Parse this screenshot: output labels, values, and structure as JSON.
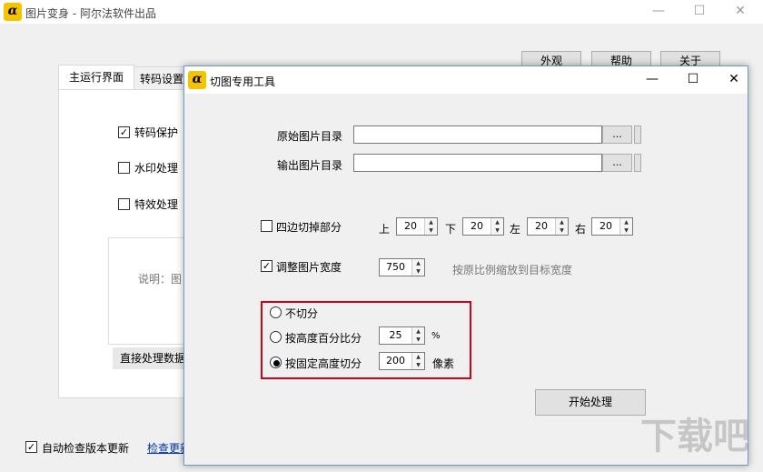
{
  "main_window": {
    "title": "图片变身 - 阿尔法软件出品",
    "logo_text": "α",
    "controls": {
      "minimize": "—",
      "maximize": "☐",
      "close": "✕"
    },
    "buttons": {
      "appearance": "外观",
      "help": "帮助",
      "about": "关于"
    },
    "tabs": [
      "主运行界面",
      "转码设置"
    ],
    "options": {
      "transcode_protect": {
        "label": "转码保护",
        "checked": true
      },
      "watermark": {
        "label": "水印处理",
        "checked": false
      },
      "effects": {
        "label": "特效处理",
        "checked": false
      }
    },
    "description_prefix": "说明：图",
    "direct_process_button": "直接处理数据",
    "auto_check_update": {
      "label": "自动检查版本更新",
      "checked": true
    },
    "check_update_link": "检查更新"
  },
  "dialog": {
    "title": "切图专用工具",
    "logo_text": "α",
    "controls": {
      "minimize": "—",
      "maximize": "☐",
      "close": "✕"
    },
    "source_dir": {
      "label": "原始图片目录",
      "value": "",
      "browse": "..."
    },
    "output_dir": {
      "label": "输出图片目录",
      "value": "",
      "browse": "..."
    },
    "trim_edges": {
      "label": "四边切掉部分",
      "checked": false,
      "top": {
        "label": "上",
        "value": "20"
      },
      "bottom": {
        "label": "下",
        "value": "20"
      },
      "left": {
        "label": "左",
        "value": "20"
      },
      "right": {
        "label": "右",
        "value": "20"
      }
    },
    "resize_width": {
      "label": "调整图片宽度",
      "checked": true,
      "value": "750",
      "hint": "按原比例缩放到目标宽度"
    },
    "split_mode": {
      "options": [
        {
          "label": "不切分",
          "selected": false
        },
        {
          "label": "按高度百分比分",
          "selected": false,
          "value": "25",
          "unit": "%"
        },
        {
          "label": "按固定高度切分",
          "selected": true,
          "value": "200",
          "unit": "像素"
        }
      ]
    },
    "start_button": "开始处理"
  },
  "watermark": {
    "text": "下载吧"
  },
  "colors": {
    "highlight_border": "#d0021b",
    "logo": "#f5c400"
  }
}
